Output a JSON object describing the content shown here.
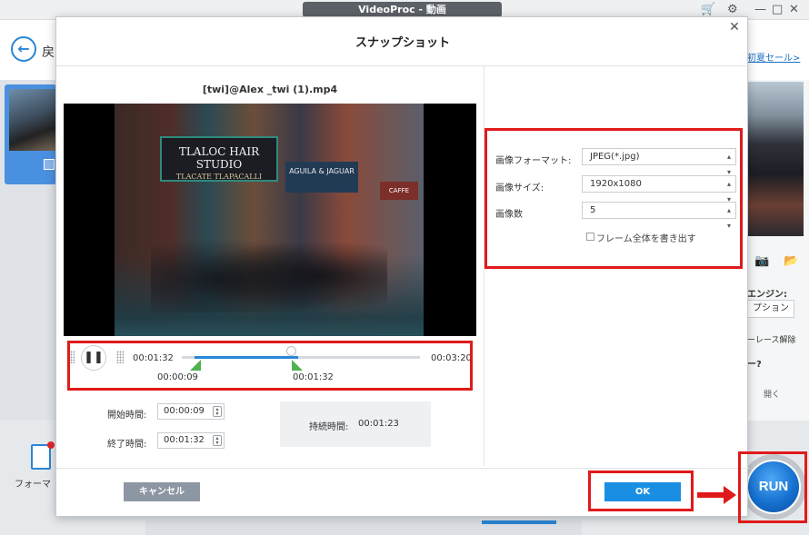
{
  "window": {
    "title": "VideoProc - 動画"
  },
  "background": {
    "back_label": "戻",
    "header_link": "初夏セール>",
    "format_label": "フォーマ",
    "engine_label": "エンジン:",
    "option_button": "プション",
    "deinterlace_label": "ーレース解除",
    "question_label": "ー?",
    "open_label": "開く",
    "run_label": "RUN"
  },
  "modal": {
    "title": "スナップショット",
    "file_name": "[twi]@Alex _twi (1).mp4",
    "preview": {
      "sign_main": "TLALOC HAIR STUDIO",
      "sign_main_sub": "TLACATE TLAPACALLI",
      "sign_second": "AGUILA & JAGUAR",
      "sign_third": "CAFFE"
    },
    "timeline": {
      "current_time": "00:01:32",
      "end_time": "00:03:20",
      "marker_start": "00:00:09",
      "marker_end": "00:01:32"
    },
    "start_time": {
      "label": "開始時間:",
      "value": "00:00:09"
    },
    "end_time_field": {
      "label": "終了時間:",
      "value": "00:01:32"
    },
    "duration": {
      "label": "持続時間:",
      "value": "00:01:23"
    },
    "settings": {
      "format": {
        "label": "画像フォーマット:",
        "value": "JPEG(*.jpg)"
      },
      "size": {
        "label": "画像サイズ:",
        "value": "1920x1080"
      },
      "count": {
        "label": "画像数",
        "value": "5"
      },
      "full_frame_label": "フレーム全体を書き出す",
      "full_frame_checked": false
    },
    "cancel_label": "キャンセル",
    "ok_label": "OK"
  },
  "colors": {
    "accent": "#1a8ee3",
    "annotation": "#e01a1a",
    "cancel": "#8d96a3",
    "marker": "#4fb34f"
  }
}
